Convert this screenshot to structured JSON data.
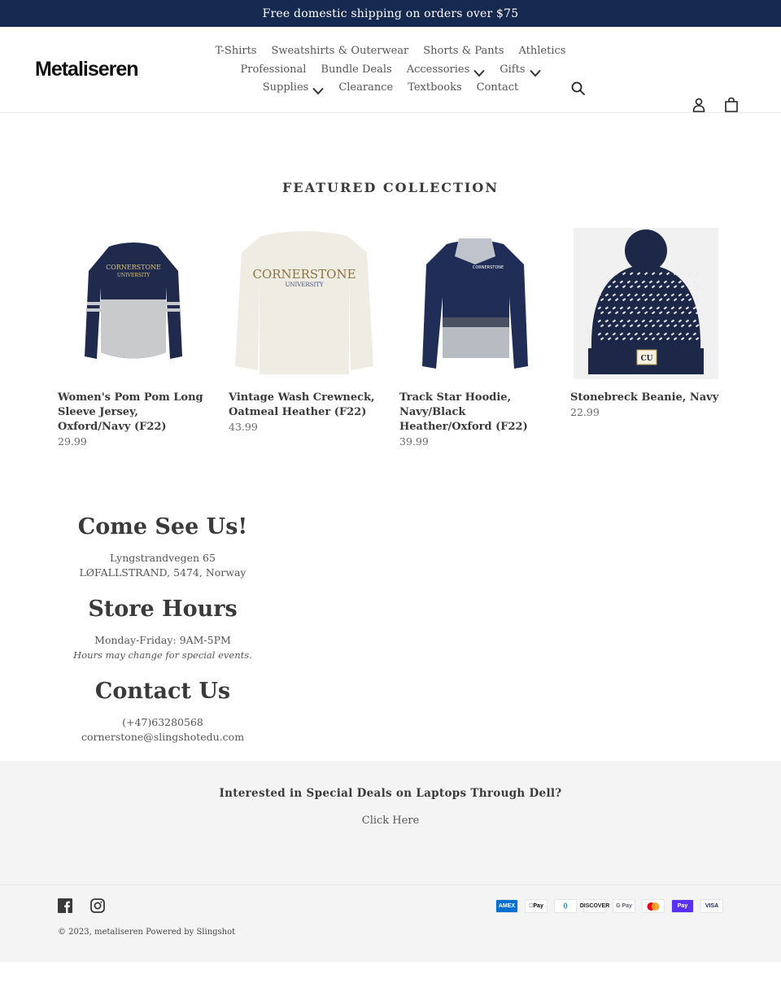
{
  "announcement": "Free domestic shipping on orders over $75",
  "header": {
    "logo": "Metaliseren",
    "nav_rows": [
      [
        {
          "label": "T-Shirts",
          "dropdown": false
        },
        {
          "label": "Sweatshirts & Outerwear",
          "dropdown": false
        },
        {
          "label": "Shorts & Pants",
          "dropdown": false
        },
        {
          "label": "Athletics",
          "dropdown": false
        }
      ],
      [
        {
          "label": "Professional",
          "dropdown": false
        },
        {
          "label": "Bundle Deals",
          "dropdown": false
        },
        {
          "label": "Accessories",
          "dropdown": true
        },
        {
          "label": "Gifts",
          "dropdown": true
        }
      ],
      [
        {
          "label": "Supplies",
          "dropdown": true
        },
        {
          "label": "Clearance",
          "dropdown": false
        },
        {
          "label": "Textbooks",
          "dropdown": false
        },
        {
          "label": "Contact",
          "dropdown": false
        }
      ]
    ],
    "icons": {
      "search": "search-icon",
      "account": "account-icon",
      "cart": "cart-icon"
    }
  },
  "featured": {
    "title": "FEATURED COLLECTION",
    "products": [
      {
        "name": "Women's Pom Pom Long Sleeve Jersey, Oxford/Navy (F22)",
        "price": "29.99",
        "image": "navy-gray-jersey"
      },
      {
        "name": "Vintage Wash Crewneck, Oatmeal Heather (F22)",
        "price": "43.99",
        "image": "oatmeal-crewneck"
      },
      {
        "name": "Track Star Hoodie, Navy/Black Heather/Oxford (F22)",
        "price": "39.99",
        "image": "navy-hoodie"
      },
      {
        "name": "Stonebreck Beanie, Navy",
        "price": "22.99",
        "image": "navy-beanie"
      }
    ]
  },
  "info": {
    "visit_heading": "Come See Us!",
    "address_line1": "Lyngstrandvegen 65",
    "address_line2": "LØFALLSTRAND, 5474, Norway",
    "hours_heading": "Store Hours",
    "hours": "Monday-Friday: 9AM-5PM",
    "hours_note": "Hours may change for special events.",
    "contact_heading": "Contact Us",
    "phone": "(+47)63280568",
    "email": "cornerstone@slingshotedu.com"
  },
  "promo": {
    "question": "Interested in Special Deals on Laptops Through Dell?",
    "link": "Click Here"
  },
  "footer": {
    "social": [
      "facebook-icon",
      "instagram-icon"
    ],
    "payments": [
      {
        "name": "American Express",
        "label": "AMEX",
        "bg": "#016fd0",
        "fg": "#ffffff"
      },
      {
        "name": "Apple Pay",
        "label": "Pay",
        "bg": "#ffffff",
        "fg": "#000000"
      },
      {
        "name": "Diners Club",
        "label": "()",
        "bg": "#ffffff",
        "fg": "#0079be"
      },
      {
        "name": "Discover",
        "label": "DISCOVER",
        "bg": "#ffffff",
        "fg": "#231f20"
      },
      {
        "name": "Google Pay",
        "label": "G Pay",
        "bg": "#ffffff",
        "fg": "#5f6368"
      },
      {
        "name": "Mastercard",
        "label": "",
        "bg": "#ffffff",
        "fg": "#eb001b"
      },
      {
        "name": "Shop Pay",
        "label": "Pay",
        "bg": "#5a31f4",
        "fg": "#ffffff"
      },
      {
        "name": "Visa",
        "label": "VISA",
        "bg": "#ffffff",
        "fg": "#1a1f71"
      }
    ],
    "copyright": "© 2023, metaliseren Powered by Slingshot"
  }
}
